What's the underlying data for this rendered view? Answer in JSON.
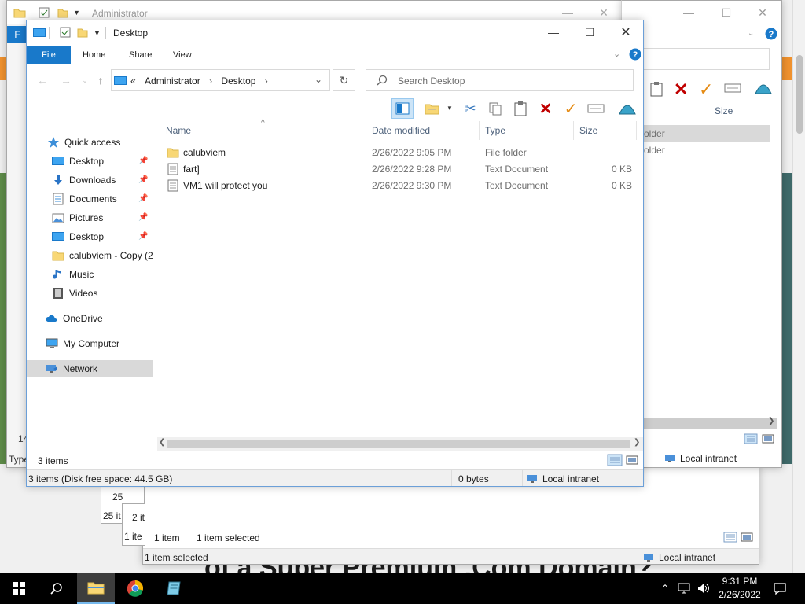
{
  "background_page": {
    "heading": "of a Super Premium .Com Domain?"
  },
  "window_admin": {
    "title": "Administrator",
    "file_tab": "F",
    "count_left": "14",
    "type_label": "Type",
    "row_25": "25",
    "row_25_it": "25 it",
    "row_2_it": "2 it",
    "row_1_ite": "1 ite"
  },
  "window_right": {
    "col_size": "Size",
    "row1": "older",
    "row2": "older",
    "zone": "Local intranet"
  },
  "window_bottom": {
    "items": "1 item",
    "selected": "1 item selected",
    "status": "1 item selected",
    "zone": "Local intranet"
  },
  "explorer": {
    "title": "Desktop",
    "tabs": [
      "File",
      "Home",
      "Share",
      "View"
    ],
    "breadcrumb": [
      "Administrator",
      "Desktop"
    ],
    "breadcrumb_prefix": "«",
    "search_placeholder": "Search Desktop",
    "nav": {
      "quick_access": "Quick access",
      "items": [
        {
          "label": "Desktop",
          "icon": "desktop-icon",
          "pinned": true
        },
        {
          "label": "Downloads",
          "icon": "downloads-icon",
          "pinned": true
        },
        {
          "label": "Documents",
          "icon": "documents-icon",
          "pinned": true
        },
        {
          "label": "Pictures",
          "icon": "pictures-icon",
          "pinned": true
        },
        {
          "label": "Desktop",
          "icon": "desktop-icon",
          "pinned": true
        },
        {
          "label": "calubviem - Copy (2",
          "icon": "folder-icon",
          "pinned": false
        },
        {
          "label": "Music",
          "icon": "music-icon",
          "pinned": false
        },
        {
          "label": "Videos",
          "icon": "videos-icon",
          "pinned": false
        }
      ],
      "onedrive": "OneDrive",
      "my_computer": "My Computer",
      "network": "Network"
    },
    "columns": [
      "Name",
      "Date modified",
      "Type",
      "Size"
    ],
    "files": [
      {
        "name": "calubviem",
        "date": "2/26/2022 9:05 PM",
        "type": "File folder",
        "size": "",
        "icon": "folder-icon"
      },
      {
        "name": "fart]",
        "date": "2/26/2022 9:28 PM",
        "type": "Text Document",
        "size": "0 KB",
        "icon": "text-file-icon"
      },
      {
        "name": "VM1 will protect you",
        "date": "2/26/2022 9:30 PM",
        "type": "Text Document",
        "size": "0 KB",
        "icon": "text-file-icon"
      }
    ],
    "item_count": "3 items",
    "status_disk": "3 items (Disk free space: 44.5 GB)",
    "status_bytes": "0 bytes",
    "status_zone": "Local intranet"
  },
  "taskbar": {
    "time": "9:31 PM",
    "date": "2/26/2022"
  }
}
